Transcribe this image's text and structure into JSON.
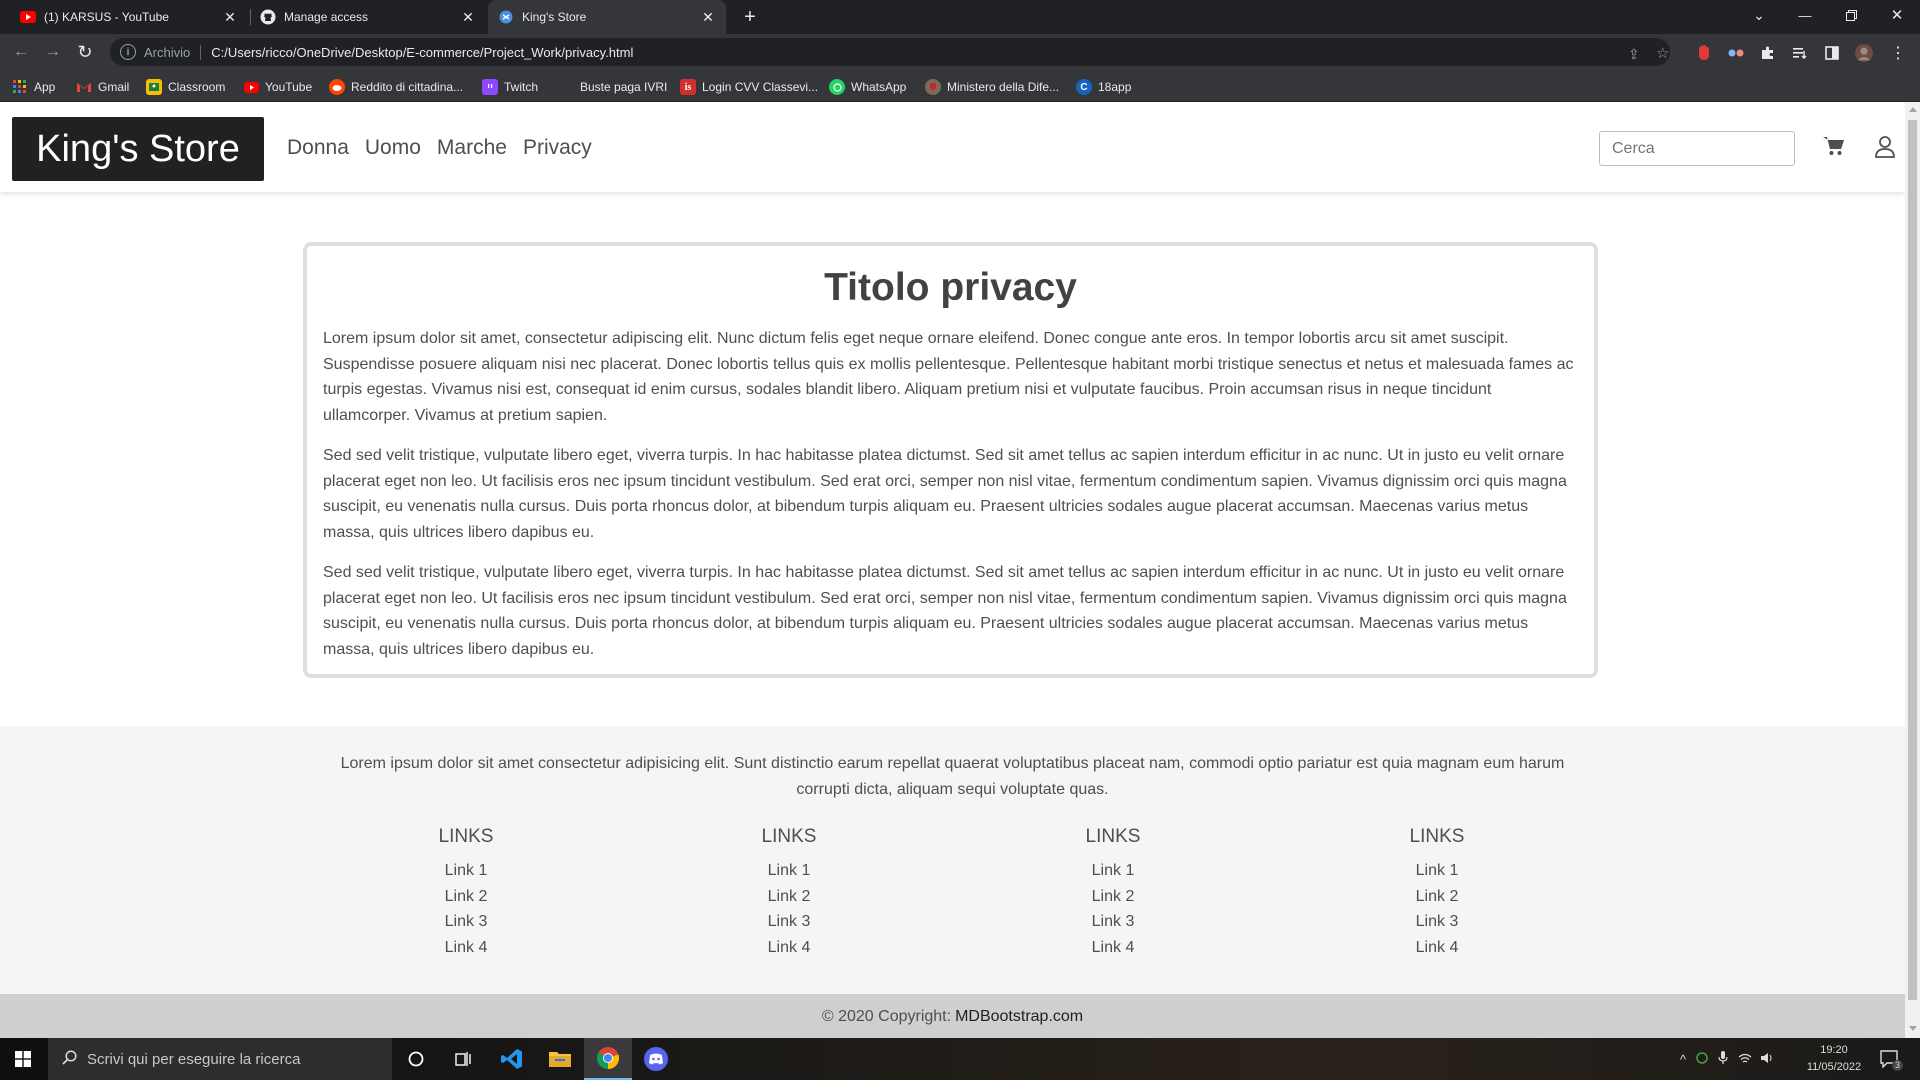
{
  "browser": {
    "tabs": [
      {
        "title": "(1) KARSUS - YouTube",
        "icon": "youtube-icon"
      },
      {
        "title": "Manage access",
        "icon": "github-icon"
      },
      {
        "title": "King's Store",
        "icon": "site-icon"
      }
    ],
    "address": {
      "security_label": "Archivio",
      "url": "C:/Users/ricco/OneDrive/Desktop/E-commerce/Project_Work/privacy.html"
    },
    "bookmarks": [
      {
        "label": "App",
        "icon": "apps-grid-icon"
      },
      {
        "label": "Gmail",
        "icon": "gmail-icon"
      },
      {
        "label": "Classroom",
        "icon": "classroom-icon"
      },
      {
        "label": "YouTube",
        "icon": "youtube-icon"
      },
      {
        "label": "Reddito di cittadina...",
        "icon": "reddit-icon"
      },
      {
        "label": "Twitch",
        "icon": "twitch-icon"
      },
      {
        "label": "Buste paga IVRI",
        "icon": "blank-icon"
      },
      {
        "label": "Login CVV Classevi...",
        "icon": "classeviva-icon"
      },
      {
        "label": "WhatsApp",
        "icon": "whatsapp-icon"
      },
      {
        "label": "Ministero della Dife...",
        "icon": "ministry-icon"
      },
      {
        "label": "18app",
        "icon": "18app-icon"
      }
    ]
  },
  "site": {
    "brand": "King's Store",
    "nav": [
      "Donna",
      "Uomo",
      "Marche",
      "Privacy"
    ],
    "search_placeholder": "Cerca",
    "privacy": {
      "title": "Titolo privacy",
      "paragraphs": [
        "Lorem ipsum dolor sit amet, consectetur adipiscing elit. Nunc dictum felis eget neque ornare eleifend. Donec congue ante eros. In tempor lobortis arcu sit amet suscipit. Suspendisse posuere aliquam nisi nec placerat. Donec lobortis tellus quis ex mollis pellentesque. Pellentesque habitant morbi tristique senectus et netus et malesuada fames ac turpis egestas. Vivamus nisi est, consequat id enim cursus, sodales blandit libero. Aliquam pretium nisi et vulputate faucibus. Proin accumsan risus in neque tincidunt ullamcorper. Vivamus at pretium sapien.",
        "Sed sed velit tristique, vulputate libero eget, viverra turpis. In hac habitasse platea dictumst. Sed sit amet tellus ac sapien interdum efficitur in ac nunc. Ut in justo eu velit ornare placerat eget non leo. Ut facilisis eros nec ipsum tincidunt vestibulum. Sed erat orci, semper non nisl vitae, fermentum condimentum sapien. Vivamus dignissim orci quis magna suscipit, eu venenatis nulla cursus. Duis porta rhoncus dolor, at bibendum turpis aliquam eu. Praesent ultricies sodales augue placerat accumsan. Maecenas varius metus massa, quis ultrices libero dapibus eu.",
        "Sed sed velit tristique, vulputate libero eget, viverra turpis. In hac habitasse platea dictumst. Sed sit amet tellus ac sapien interdum efficitur in ac nunc. Ut in justo eu velit ornare placerat eget non leo. Ut facilisis eros nec ipsum tincidunt vestibulum. Sed erat orci, semper non nisl vitae, fermentum condimentum sapien. Vivamus dignissim orci quis magna suscipit, eu venenatis nulla cursus. Duis porta rhoncus dolor, at bibendum turpis aliquam eu. Praesent ultricies sodales augue placerat accumsan. Maecenas varius metus massa, quis ultrices libero dapibus eu."
      ]
    },
    "footer": {
      "intro": "Lorem ipsum dolor sit amet consectetur adipisicing elit. Sunt distinctio earum repellat quaerat voluptatibus placeat nam, commodi optio pariatur est quia magnam eum harum corrupti dicta, aliquam sequi voluptate quas.",
      "columns": [
        {
          "heading": "LINKS",
          "links": [
            "Link 1",
            "Link 2",
            "Link 3",
            "Link 4"
          ]
        },
        {
          "heading": "LINKS",
          "links": [
            "Link 1",
            "Link 2",
            "Link 3",
            "Link 4"
          ]
        },
        {
          "heading": "LINKS",
          "links": [
            "Link 1",
            "Link 2",
            "Link 3",
            "Link 4"
          ]
        },
        {
          "heading": "LINKS",
          "links": [
            "Link 1",
            "Link 2",
            "Link 3",
            "Link 4"
          ]
        }
      ],
      "copyright_prefix": "© 2020 Copyright:",
      "copyright_link": "MDBootstrap.com"
    }
  },
  "taskbar": {
    "search_placeholder": "Scrivi qui per eseguire la ricerca",
    "time": "19:20",
    "date": "11/05/2022",
    "notification_count": "3"
  },
  "colors": {
    "brand_bg": "#212121",
    "footer_bg": "#f5f5f5",
    "copyright_bg": "#cfcfcf"
  }
}
